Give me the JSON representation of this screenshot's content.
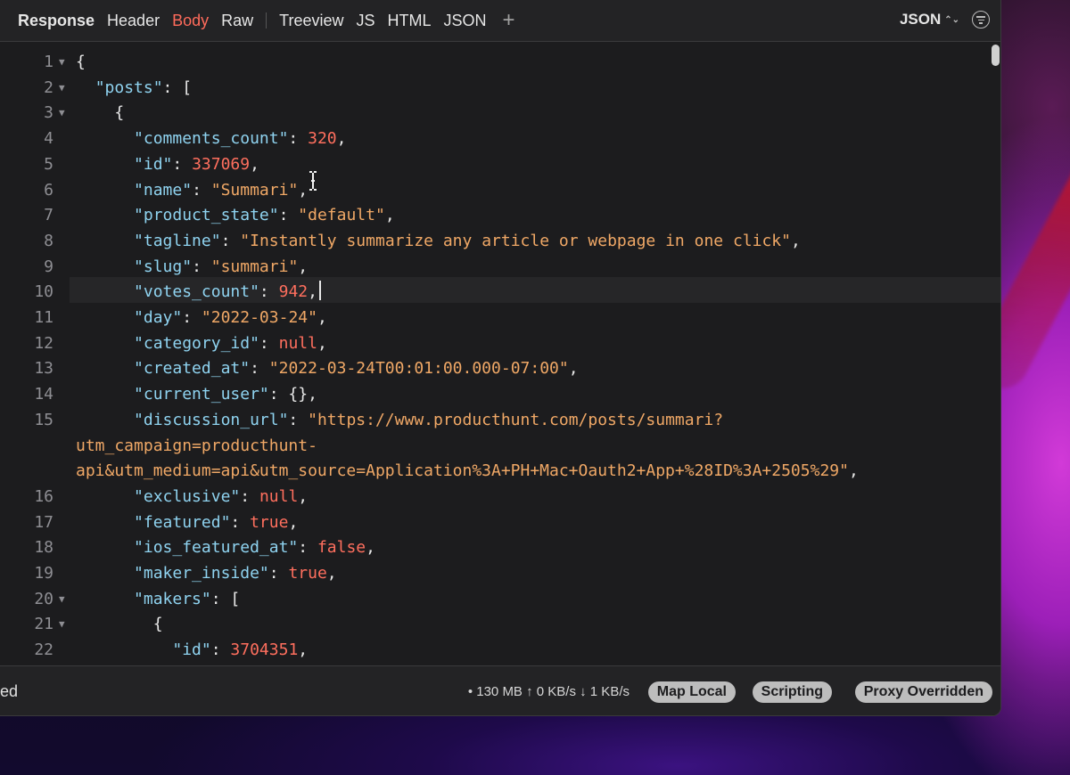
{
  "header": {
    "title": "Response",
    "tabs": [
      "Header",
      "Body",
      "Raw"
    ],
    "views": [
      "Treeview",
      "JS",
      "HTML",
      "JSON"
    ],
    "add_label": "+",
    "format_label": "JSON",
    "format_chevron": "⌃⌄"
  },
  "editor": {
    "lines": [
      {
        "n": "1",
        "fold": "▼",
        "tokens": [
          [
            "p",
            "{"
          ]
        ]
      },
      {
        "n": "2",
        "fold": "▼",
        "tokens": [
          [
            "p",
            "  "
          ],
          [
            "k",
            "\"posts\""
          ],
          [
            "p",
            ": ["
          ]
        ]
      },
      {
        "n": "3",
        "fold": "▼",
        "tokens": [
          [
            "p",
            "    {"
          ]
        ]
      },
      {
        "n": "4",
        "fold": "",
        "tokens": [
          [
            "p",
            "      "
          ],
          [
            "k",
            "\"comments_count\""
          ],
          [
            "p",
            ": "
          ],
          [
            "n",
            "320"
          ],
          [
            "p",
            ","
          ]
        ]
      },
      {
        "n": "5",
        "fold": "",
        "tokens": [
          [
            "p",
            "      "
          ],
          [
            "k",
            "\"id\""
          ],
          [
            "p",
            ": "
          ],
          [
            "n",
            "337069"
          ],
          [
            "p",
            ","
          ]
        ]
      },
      {
        "n": "6",
        "fold": "",
        "tokens": [
          [
            "p",
            "      "
          ],
          [
            "k",
            "\"name\""
          ],
          [
            "p",
            ": "
          ],
          [
            "s",
            "\"Summari\""
          ],
          [
            "p",
            ","
          ]
        ]
      },
      {
        "n": "7",
        "fold": "",
        "tokens": [
          [
            "p",
            "      "
          ],
          [
            "k",
            "\"product_state\""
          ],
          [
            "p",
            ": "
          ],
          [
            "s",
            "\"default\""
          ],
          [
            "p",
            ","
          ]
        ]
      },
      {
        "n": "8",
        "fold": "",
        "tokens": [
          [
            "p",
            "      "
          ],
          [
            "k",
            "\"tagline\""
          ],
          [
            "p",
            ": "
          ],
          [
            "s",
            "\"Instantly summarize any article or webpage in one click\""
          ],
          [
            "p",
            ","
          ]
        ]
      },
      {
        "n": "9",
        "fold": "",
        "tokens": [
          [
            "p",
            "      "
          ],
          [
            "k",
            "\"slug\""
          ],
          [
            "p",
            ": "
          ],
          [
            "s",
            "\"summari\""
          ],
          [
            "p",
            ","
          ]
        ]
      },
      {
        "n": "10",
        "fold": "",
        "cursor": true,
        "tokens": [
          [
            "p",
            "      "
          ],
          [
            "k",
            "\"votes_count\""
          ],
          [
            "p",
            ": "
          ],
          [
            "n",
            "942"
          ],
          [
            "p",
            ","
          ]
        ]
      },
      {
        "n": "11",
        "fold": "",
        "tokens": [
          [
            "p",
            "      "
          ],
          [
            "k",
            "\"day\""
          ],
          [
            "p",
            ": "
          ],
          [
            "s",
            "\"2022-03-24\""
          ],
          [
            "p",
            ","
          ]
        ]
      },
      {
        "n": "12",
        "fold": "",
        "tokens": [
          [
            "p",
            "      "
          ],
          [
            "k",
            "\"category_id\""
          ],
          [
            "p",
            ": "
          ],
          [
            "n",
            "null"
          ],
          [
            "p",
            ","
          ]
        ]
      },
      {
        "n": "13",
        "fold": "",
        "tokens": [
          [
            "p",
            "      "
          ],
          [
            "k",
            "\"created_at\""
          ],
          [
            "p",
            ": "
          ],
          [
            "s",
            "\"2022-03-24T00:01:00.000-07:00\""
          ],
          [
            "p",
            ","
          ]
        ]
      },
      {
        "n": "14",
        "fold": "",
        "tokens": [
          [
            "p",
            "      "
          ],
          [
            "k",
            "\"current_user\""
          ],
          [
            "p",
            ": {},"
          ]
        ]
      },
      {
        "n": "15",
        "fold": "",
        "tokens": [
          [
            "p",
            "      "
          ],
          [
            "k",
            "\"discussion_url\""
          ],
          [
            "p",
            ": "
          ],
          [
            "s",
            "\"https://www.producthunt.com/posts/summari?"
          ]
        ]
      },
      {
        "n": "",
        "fold": "",
        "tokens": [
          [
            "s",
            "utm_campaign=producthunt-"
          ]
        ]
      },
      {
        "n": "",
        "fold": "",
        "tokens": [
          [
            "s",
            "api&utm_medium=api&utm_source=Application%3A+PH+Mac+Oauth2+App+%28ID%3A+2505%29\""
          ],
          [
            "p",
            ","
          ]
        ]
      },
      {
        "n": "16",
        "fold": "",
        "tokens": [
          [
            "p",
            "      "
          ],
          [
            "k",
            "\"exclusive\""
          ],
          [
            "p",
            ": "
          ],
          [
            "n",
            "null"
          ],
          [
            "p",
            ","
          ]
        ]
      },
      {
        "n": "17",
        "fold": "",
        "tokens": [
          [
            "p",
            "      "
          ],
          [
            "k",
            "\"featured\""
          ],
          [
            "p",
            ": "
          ],
          [
            "n",
            "true"
          ],
          [
            "p",
            ","
          ]
        ]
      },
      {
        "n": "18",
        "fold": "",
        "tokens": [
          [
            "p",
            "      "
          ],
          [
            "k",
            "\"ios_featured_at\""
          ],
          [
            "p",
            ": "
          ],
          [
            "n",
            "false"
          ],
          [
            "p",
            ","
          ]
        ]
      },
      {
        "n": "19",
        "fold": "",
        "tokens": [
          [
            "p",
            "      "
          ],
          [
            "k",
            "\"maker_inside\""
          ],
          [
            "p",
            ": "
          ],
          [
            "n",
            "true"
          ],
          [
            "p",
            ","
          ]
        ]
      },
      {
        "n": "20",
        "fold": "▼",
        "tokens": [
          [
            "p",
            "      "
          ],
          [
            "k",
            "\"makers\""
          ],
          [
            "p",
            ": ["
          ]
        ]
      },
      {
        "n": "21",
        "fold": "▼",
        "tokens": [
          [
            "p",
            "        {"
          ]
        ]
      },
      {
        "n": "22",
        "fold": "",
        "tokens": [
          [
            "p",
            "          "
          ],
          [
            "k",
            "\"id\""
          ],
          [
            "p",
            ": "
          ],
          [
            "n",
            "3704351"
          ],
          [
            "p",
            ","
          ]
        ]
      }
    ]
  },
  "status": {
    "left_text": "ed",
    "info": "• 130 MB ↑ 0 KB/s ↓ 1 KB/s",
    "buttons": [
      "Map Local",
      "Scripting",
      "Proxy Overridden"
    ]
  }
}
